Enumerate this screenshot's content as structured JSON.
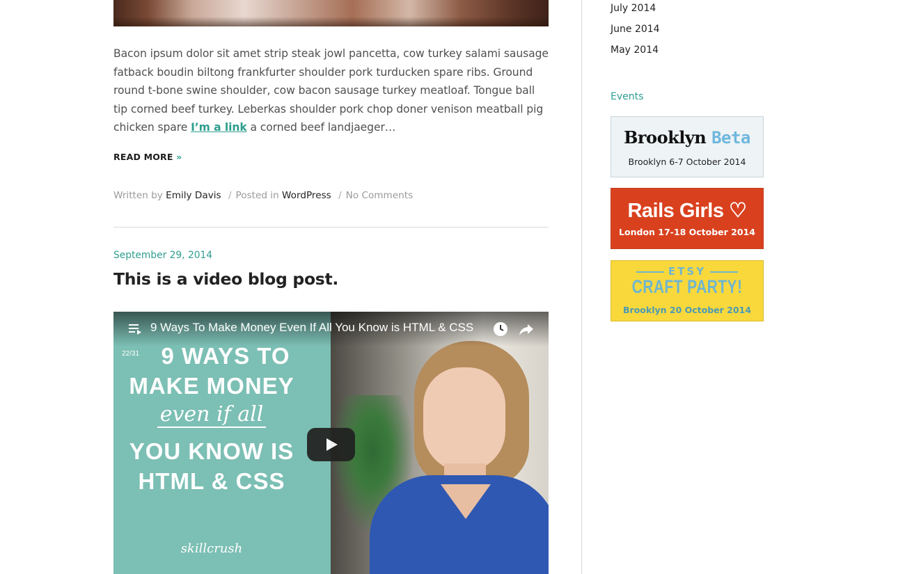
{
  "post_one": {
    "excerpt_text": "Bacon ipsum dolor sit amet strip steak jowl pancetta, cow turkey salami sausage fatback boudin biltong frankfurter shoulder pork turducken spare ribs. Ground round t-bone swine shoulder, cow bacon sausage turkey meatloaf. Tongue ball tip corned beef turkey. Leberkas shoulder pork chop doner venison meatball pig chicken spare ",
    "excerpt_link": "I’m a link",
    "excerpt_tail": " a corned beef landjaeger…",
    "read_more_label": "READ MORE",
    "read_more_arrow": "»",
    "meta": {
      "written_by_label": "Written by",
      "author": "Emily Davis",
      "separator": "/",
      "posted_in_label": "Posted in",
      "category": "WordPress",
      "comments": "No Comments"
    }
  },
  "post_two": {
    "date": "September 29, 2014",
    "title": "This is a video blog post.",
    "video": {
      "title": "9 Ways To Make Money Even If All You Know is HTML & CSS",
      "counter": "22/31",
      "thumb_line1": "9 WAYS TO",
      "thumb_line2": "MAKE MONEY",
      "thumb_line3": "even if all",
      "thumb_line4": "YOU KNOW IS",
      "thumb_line5": "HTML & CSS",
      "thumb_brand": "skillcrush"
    }
  },
  "sidebar": {
    "archives": [
      "July 2014",
      "June 2014",
      "May 2014"
    ],
    "events_title": "Events",
    "events": [
      {
        "title_main": "Brooklyn",
        "title_accent": "Beta",
        "subtitle": "Brooklyn 6-7 October 2014",
        "bg": "#eef3f5"
      },
      {
        "title_main": "Rails Girls ♡",
        "subtitle": "London 17-18 October 2014",
        "bg": "#d9411e"
      },
      {
        "kicker": "ETSY",
        "title_main": "CRAFT PARTY!",
        "subtitle": "Brooklyn 20 October 2014",
        "bg": "#f9d83c"
      }
    ]
  },
  "colors": {
    "accent": "#2e9e8f",
    "text": "#505050",
    "divider": "#d9d9d9"
  }
}
